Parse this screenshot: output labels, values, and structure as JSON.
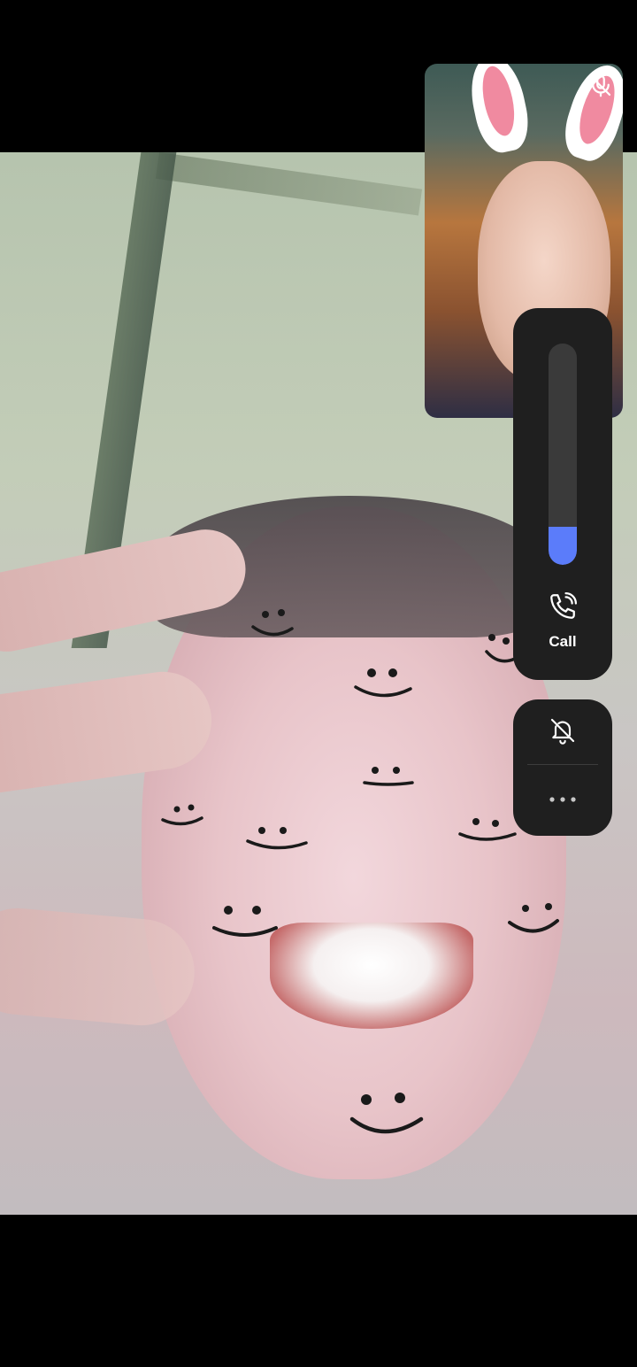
{
  "call": {
    "label": "Call",
    "volume_level_fraction": 0.17
  },
  "icons": {
    "self_preview_mic": "mic-off-icon",
    "call": "phone-call-icon",
    "notifications": "bell-off-icon",
    "more": "more-horizontal-icon"
  },
  "colors": {
    "background": "#000000",
    "panel": "#1f1f1f",
    "volume_track": "#3a3a3a",
    "volume_fill": "#5b7cfa",
    "icon": "#ffffff"
  }
}
